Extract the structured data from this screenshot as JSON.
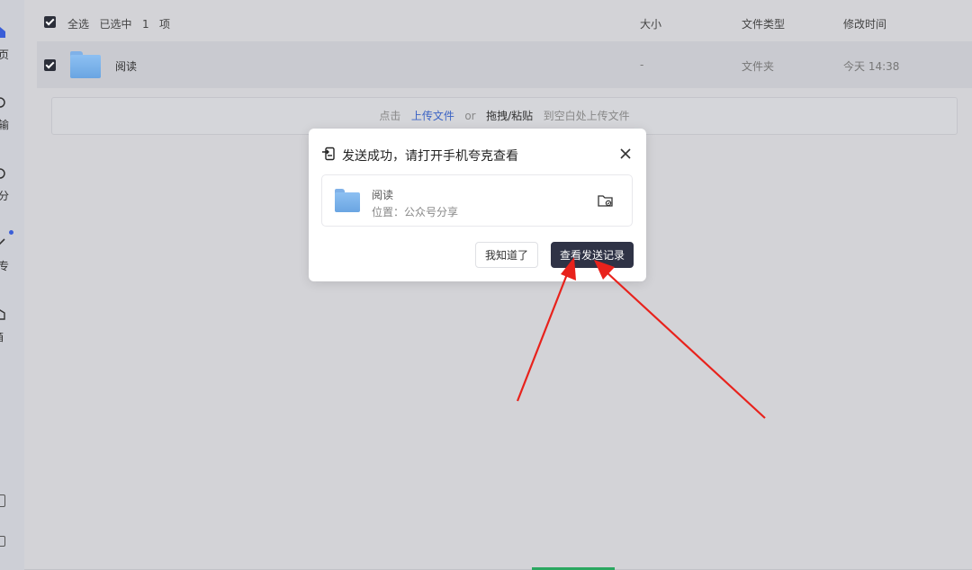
{
  "sidebar": {
    "items": [
      {
        "label": "页",
        "icon": "home-icon"
      },
      {
        "label": "输",
        "icon": "transfer-icon"
      },
      {
        "label": "分",
        "icon": "share-icon"
      },
      {
        "label": "专",
        "icon": "edit-icon"
      },
      {
        "label": "箱",
        "icon": "toolbox-icon"
      }
    ]
  },
  "list": {
    "header": {
      "select_all": "全选",
      "selected_prefix": "已选中",
      "selected_count": "1",
      "selected_unit": "项",
      "col_size": "大小",
      "col_type": "文件类型",
      "col_modified": "修改时间"
    },
    "rows": [
      {
        "name": "阅读",
        "size": "-",
        "type": "文件夹",
        "modified": "今天 14:38",
        "checked": true
      }
    ]
  },
  "upload_hint": {
    "click": "点击",
    "upload_link": "上传文件",
    "or": "or",
    "drag": "拖拽/粘贴",
    "suffix": "到空白处上传文件"
  },
  "modal": {
    "title": "发送成功，请打开手机夸克查看",
    "file_name": "阅读",
    "location": "位置：公众号分享",
    "btn_ok": "我知道了",
    "btn_view": "查看发送记录"
  },
  "colors": {
    "accent_dark": "#2f3346",
    "link": "#3b63c4",
    "annotation": "#e8221c"
  }
}
